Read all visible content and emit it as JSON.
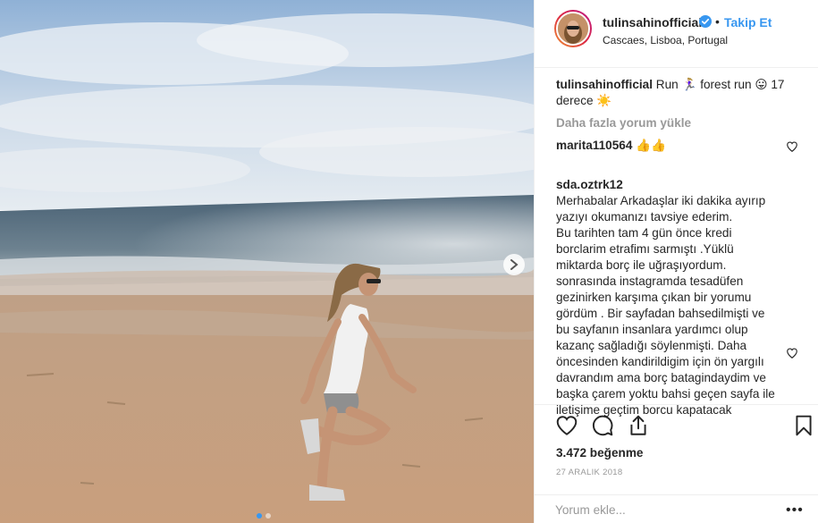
{
  "post": {
    "username": "tulinsahinofficial",
    "separator": "•",
    "follow_label": "Takip Et",
    "location": "Cascaes, Lisboa, Portugal",
    "caption_user": "tulinsahinofficial",
    "caption_text": "Run 🏃🏼‍♀️ forest run 😛 17 derece ☀️",
    "load_more": "Daha fazla yorum yükle",
    "comments": [
      {
        "user": "marita110564",
        "text": "👍👍"
      },
      {
        "user": "sda.oztrk12",
        "text": "Merhabalar Arkadaşlar iki dakika ayırıp yazıyı okumanızı tavsiye ederim.\nBu tarihten tam 4 gün önce kredi borclarim etrafimı sarmıştı .Yüklü miktarda borç ile uğraşıyordum.\nsonrasında instagramda tesadüfen gezinirken karşıma çıkan bir yorumu gördüm . Bir sayfadan bahsedilmişti ve bu sayfanın insanlara yardımcı olup kazanç sağladığı söylenmişti. Daha öncesinden kandirildigim için ön yargılı davrandım ama borç batagindaydim ve başka çarem yoktu bahsi geçen sayfa ile iletişime geçtim borcu kapatacak"
      }
    ],
    "likes": "3.472 beğenme",
    "date": "27 ARALIK 2018",
    "comment_placeholder": "Yorum ekle...",
    "more_label": "•••"
  },
  "colors": {
    "link_blue": "#3897f0",
    "text": "#262626",
    "muted": "#999999",
    "border": "#efefef"
  },
  "icons": {
    "next": "chevron-right-icon",
    "verified": "verified-badge-icon",
    "like": "heart-icon",
    "comment": "comment-bubble-icon",
    "share": "share-icon",
    "save": "bookmark-icon"
  },
  "carousel": {
    "total_slides": 2,
    "active_slide": 1
  }
}
